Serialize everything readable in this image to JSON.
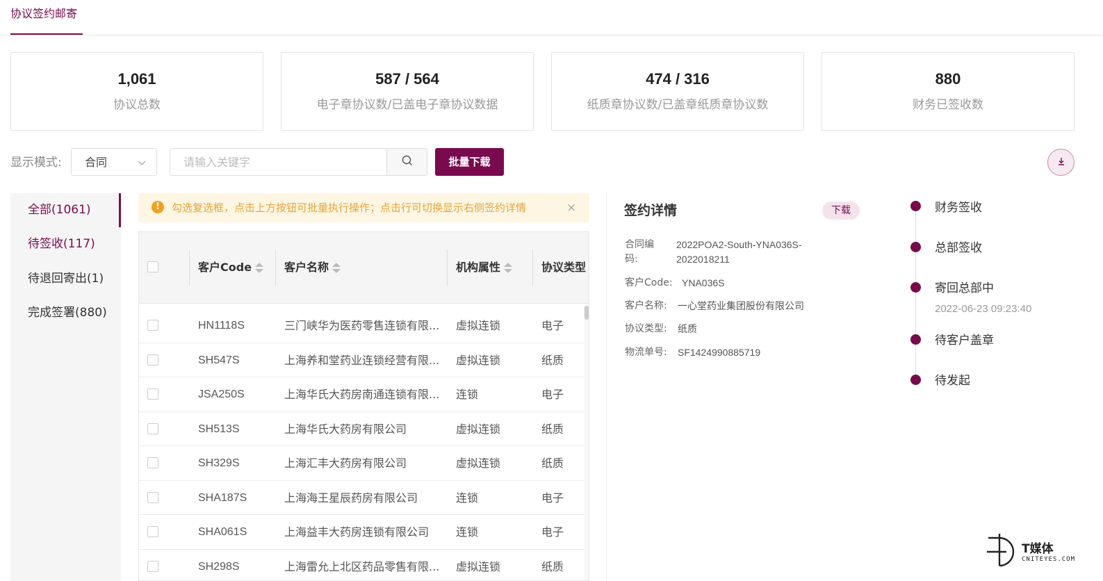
{
  "top_tab": {
    "label": "协议签约邮寄"
  },
  "stats": [
    {
      "value": "1,061",
      "label": "协议总数"
    },
    {
      "value": "587 / 564",
      "label": "电子章协议数/已盖电子章协议数据"
    },
    {
      "value": "474 / 316",
      "label": "纸质章协议数/已盖章纸质章协议数"
    },
    {
      "value": "880",
      "label": "财务已签收数"
    }
  ],
  "controls": {
    "mode_label": "显示模式:",
    "mode_value": "合同",
    "search_placeholder": "请输入关键字",
    "batch_download": "批量下载"
  },
  "sidebar": {
    "items": [
      {
        "label": "全部(1061)"
      },
      {
        "label": "待签收(117)"
      },
      {
        "label": "待退回寄出(1)"
      },
      {
        "label": "完成签署(880)"
      }
    ]
  },
  "notice": {
    "text": "勾选复选框，点击上方按钮可批量执行操作；点击行可切换显示右侧签约详情",
    "close": "×"
  },
  "table": {
    "headers": [
      "客户Code",
      "客户名称",
      "机构属性",
      "协议类型"
    ],
    "rows": [
      {
        "code": "HN1118S",
        "name": "三门峡华为医药零售连锁有限...",
        "org": "虚拟连锁",
        "type": "电子"
      },
      {
        "code": "SH547S",
        "name": "上海养和堂药业连锁经营有限...",
        "org": "虚拟连锁",
        "type": "纸质"
      },
      {
        "code": "JSA250S",
        "name": "上海华氏大药房南通连锁有限...",
        "org": "连锁",
        "type": "电子"
      },
      {
        "code": "SH513S",
        "name": "上海华氏大药房有限公司",
        "org": "虚拟连锁",
        "type": "纸质"
      },
      {
        "code": "SH329S",
        "name": "上海汇丰大药房有限公司",
        "org": "虚拟连锁",
        "type": "纸质"
      },
      {
        "code": "SHA187S",
        "name": "上海海王星辰药房有限公司",
        "org": "连锁",
        "type": "电子"
      },
      {
        "code": "SHA061S",
        "name": "上海益丰大药房连锁有限公司",
        "org": "连锁",
        "type": "电子"
      },
      {
        "code": "SH298S",
        "name": "上海雷允上北区药品零售有限...",
        "org": "虚拟连锁",
        "type": "纸质"
      }
    ]
  },
  "detail": {
    "title": "签约详情",
    "download": "下载",
    "contract_label_1": "合同编",
    "contract_label_2": "码:",
    "contract_value_1": "2022POA2-South-YNA036S-",
    "contract_value_2": "2022018211",
    "code_label": "客户Code:",
    "code_value": "YNA036S",
    "name_label": "客户名称:",
    "name_value": "一心堂药业集团股份有限公司",
    "type_label": "协议类型:",
    "type_value": "纸质",
    "logistics_label": "物流单号:",
    "logistics_value": "SF1424990885719"
  },
  "timeline": [
    {
      "label": "财务签收"
    },
    {
      "label": "总部签收"
    },
    {
      "label": "寄回总部中",
      "time": "2022-06-23 09:23:40"
    },
    {
      "label": "待客户盖章"
    },
    {
      "label": "待发起"
    }
  ],
  "watermark": {
    "name": "T媒体",
    "sub": "CNITEYES.COM"
  },
  "colors": {
    "accent": "#7a0a4e",
    "notice_text": "#e8a33a",
    "notice_bg": "#fdf6e3"
  },
  "icons": [
    "search-icon",
    "chevron-down-icon",
    "download-icon",
    "warning-icon",
    "close-icon",
    "sort-icon"
  ]
}
